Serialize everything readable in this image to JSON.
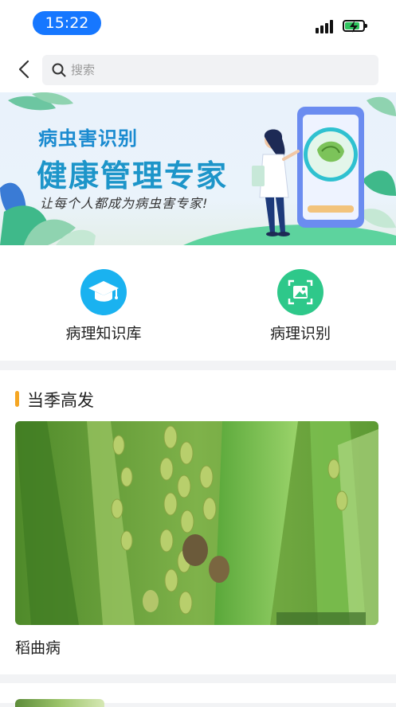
{
  "status_bar": {
    "time": "15:22",
    "battery_color": "#2fc45e",
    "battery_level": 0.8,
    "pill_color": "#1677ff"
  },
  "header": {
    "back_icon": "chevron-left-icon",
    "search": {
      "placeholder": "搜索",
      "icon": "search-icon"
    }
  },
  "banner": {
    "title_small": "病虫害识别",
    "title_large": "健康管理专家",
    "slogan": "让每个人都成为病虫害专家!"
  },
  "quick_actions": [
    {
      "label": "病理知识库",
      "icon": "graduation-cap-icon",
      "color": "#1ab2f0"
    },
    {
      "label": "病理识别",
      "icon": "image-scan-icon",
      "color": "#2ec88a"
    }
  ],
  "section": {
    "title": "当季高发",
    "accent_color": "#f5a623",
    "card": {
      "caption": "稻曲病",
      "image": "rice-panicle-photo"
    }
  }
}
